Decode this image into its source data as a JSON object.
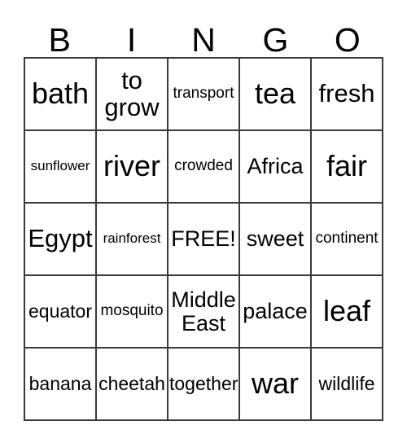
{
  "card": {
    "header": [
      "B",
      "I",
      "N",
      "G",
      "O"
    ],
    "free_space_label": "FREE!",
    "rows": [
      [
        {
          "text": "bath",
          "size": "xxl"
        },
        {
          "text": "to\ngrow",
          "size": "xl"
        },
        {
          "text": "transport",
          "size": "s"
        },
        {
          "text": "tea",
          "size": "xxl"
        },
        {
          "text": "fresh",
          "size": "xl"
        }
      ],
      [
        {
          "text": "sunflower",
          "size": "xs"
        },
        {
          "text": "river",
          "size": "xxl"
        },
        {
          "text": "crowded",
          "size": "s"
        },
        {
          "text": "Africa",
          "size": "l"
        },
        {
          "text": "fair",
          "size": "xxl"
        }
      ],
      [
        {
          "text": "Egypt",
          "size": "xl"
        },
        {
          "text": "rainforest",
          "size": "xs"
        },
        {
          "text": "FREE!",
          "size": "l"
        },
        {
          "text": "sweet",
          "size": "l"
        },
        {
          "text": "continent",
          "size": "s"
        }
      ],
      [
        {
          "text": "equator",
          "size": "m"
        },
        {
          "text": "mosquito",
          "size": "s"
        },
        {
          "text": "Middle\nEast",
          "size": "l"
        },
        {
          "text": "palace",
          "size": "l"
        },
        {
          "text": "leaf",
          "size": "xxl"
        }
      ],
      [
        {
          "text": "banana",
          "size": "m"
        },
        {
          "text": "cheetah",
          "size": "m"
        },
        {
          "text": "together",
          "size": "m"
        },
        {
          "text": "war",
          "size": "xxl"
        },
        {
          "text": "wildlife",
          "size": "m"
        }
      ]
    ]
  },
  "colors": {
    "border": "#3a3a3a",
    "text": "#000000",
    "background": "#ffffff"
  }
}
